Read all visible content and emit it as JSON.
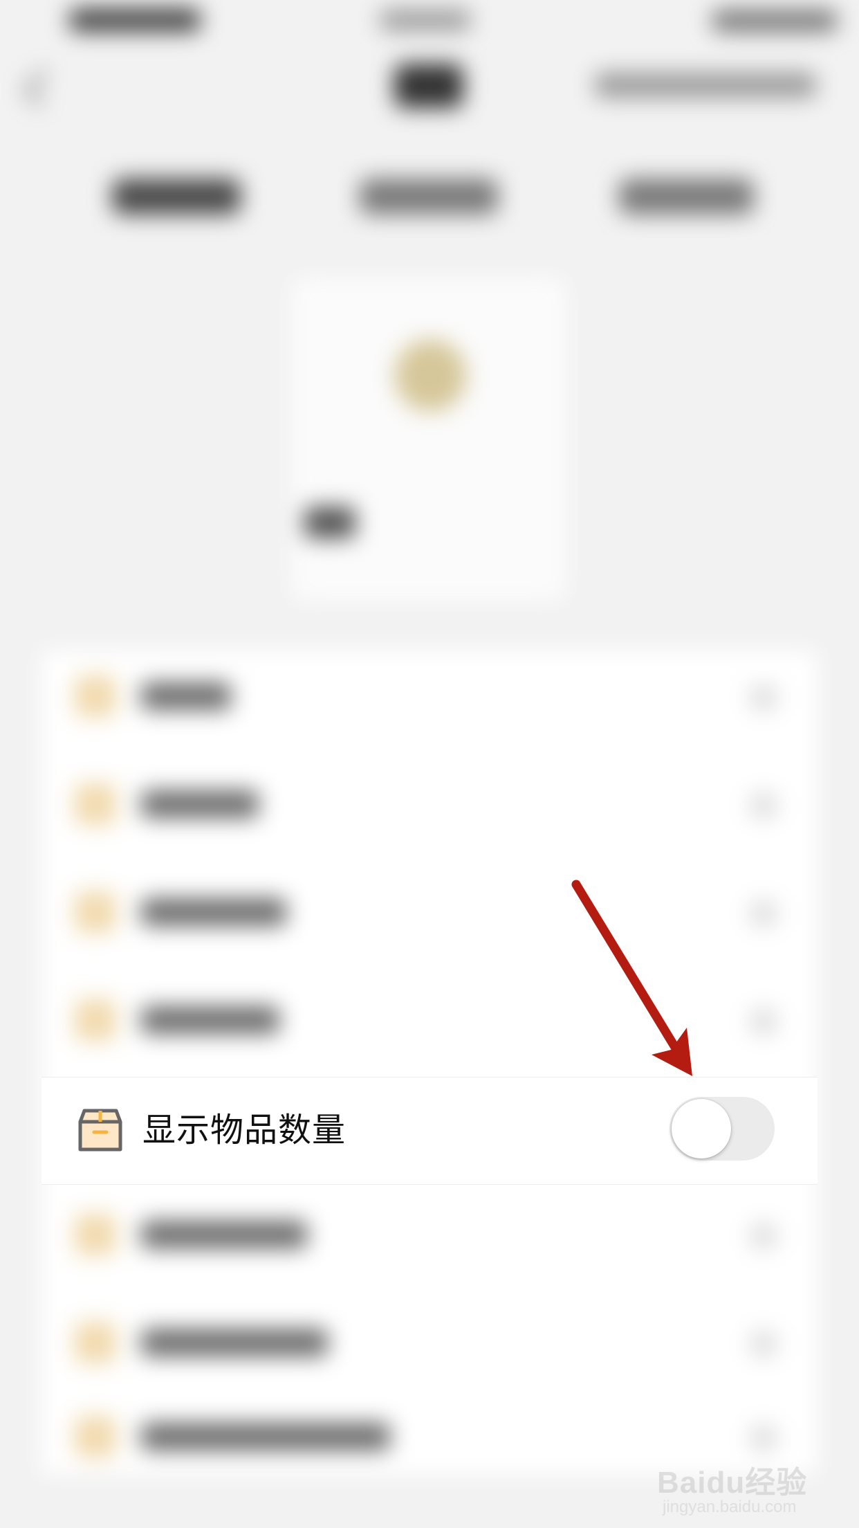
{
  "setting_row": {
    "label": "显示物品数量",
    "toggle_on": false,
    "icon": "box-icon"
  },
  "colors": {
    "arrow": "#b41c12",
    "icon_stroke": "#666666",
    "icon_accent": "#f5b540",
    "icon_fill": "#fde7c7",
    "toggle_track_off": "#ebebeb"
  },
  "watermark": {
    "brand": "Baidu经验",
    "url": "jingyan.baidu.com"
  }
}
